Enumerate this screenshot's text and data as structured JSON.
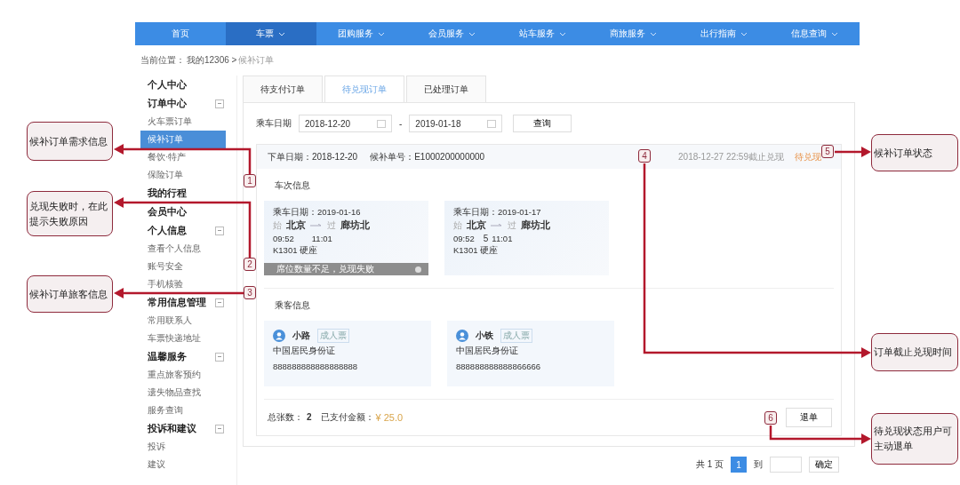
{
  "nav": [
    {
      "label": "首页",
      "selected": false,
      "dropdown": false
    },
    {
      "label": "车票",
      "selected": true,
      "dropdown": true
    },
    {
      "label": "团购服务",
      "selected": false,
      "dropdown": true
    },
    {
      "label": "会员服务",
      "selected": false,
      "dropdown": true
    },
    {
      "label": "站车服务",
      "selected": false,
      "dropdown": true
    },
    {
      "label": "商旅服务",
      "selected": false,
      "dropdown": true
    },
    {
      "label": "出行指南",
      "selected": false,
      "dropdown": true
    },
    {
      "label": "信息查询",
      "selected": false,
      "dropdown": true
    }
  ],
  "breadcrumb": {
    "label": "当前位置：",
    "path": "我的12306 >",
    "current": "候补订单"
  },
  "sidebar": [
    {
      "label": "个人中心",
      "collapsible": false
    },
    {
      "label": "订单中心",
      "collapsible": true,
      "children": [
        {
          "label": "火车票订单",
          "selected": false
        },
        {
          "label": "候补订单",
          "selected": true
        },
        {
          "label": "餐饮·特产",
          "selected": false
        },
        {
          "label": "保险订单",
          "selected": false
        }
      ]
    },
    {
      "label": "我的行程",
      "collapsible": false
    },
    {
      "label": "会员中心",
      "collapsible": false
    },
    {
      "label": "个人信息",
      "collapsible": true,
      "children": [
        {
          "label": "查看个人信息",
          "selected": false
        },
        {
          "label": "账号安全",
          "selected": false
        },
        {
          "label": "手机核验",
          "selected": false
        }
      ]
    },
    {
      "label": "常用信息管理",
      "collapsible": true,
      "children": [
        {
          "label": "常用联系人",
          "selected": false
        },
        {
          "label": "车票快递地址",
          "selected": false
        }
      ]
    },
    {
      "label": "温馨服务",
      "collapsible": true,
      "children": [
        {
          "label": "重点旅客预约",
          "selected": false
        },
        {
          "label": "遗失物品查找",
          "selected": false
        },
        {
          "label": "服务查询",
          "selected": false
        }
      ]
    },
    {
      "label": "投诉和建议",
      "collapsible": true,
      "children": [
        {
          "label": "投诉",
          "selected": false
        },
        {
          "label": "建议",
          "selected": false
        }
      ]
    }
  ],
  "tabs": [
    {
      "label": "待支付订单",
      "selected": false
    },
    {
      "label": "待兑现订单",
      "selected": true
    },
    {
      "label": "已处理订单",
      "selected": false
    }
  ],
  "filter": {
    "label": "乘车日期",
    "start": "2018-12-20",
    "separator": "-",
    "end": "2019-01-18",
    "button": "查询"
  },
  "order": {
    "date_label": "下单日期：",
    "date": "2018-12-20",
    "number_label": "候补单号：",
    "number": "E1000200000000",
    "deadline": "2018-12-27 22:59截止兑现",
    "status": "待兑现",
    "trips_title": "车次信息",
    "trips": [
      {
        "date": "乘车日期：2019-01-16",
        "from_tag": "始",
        "from": "北京",
        "to_tag": "过",
        "to": "廊坊北",
        "depart": "09:52",
        "arrive": "11:01",
        "train": "K1301 硬座",
        "failure": "席位数量不足，兑现失败"
      },
      {
        "date": "乘车日期：2019-01-17",
        "from_tag": "始",
        "from": "北京",
        "to_tag": "过",
        "to": "廊坊北",
        "depart": "09:52",
        "stray_mark": "5",
        "arrive": "11:01",
        "train": "K1301 硬座"
      }
    ],
    "passengers_title": "乘客信息",
    "passengers": [
      {
        "name": "小路",
        "tag": "成人票",
        "id_type": "中国居民身份证",
        "id_number": "888888888888888888"
      },
      {
        "name": "小铁",
        "tag": "成人票",
        "id_type": "中国居民身份证",
        "id_number": "888888888888866666"
      }
    ],
    "total_label": "总张数：",
    "total": "2",
    "paid_label": "已支付金额：",
    "paid": "¥ 25.0",
    "refund_button": "退单"
  },
  "pagination": {
    "pages": "共 1 页",
    "current": "1",
    "goto": "到",
    "confirm": "确定"
  },
  "annotations": [
    {
      "number": "1",
      "text": "候补订单需求信息"
    },
    {
      "number": "2",
      "text": "兑现失败时，在此提示失败原因"
    },
    {
      "number": "3",
      "text": "候补订单旅客信息"
    },
    {
      "number": "5",
      "text": "候补订单状态"
    },
    {
      "number": "4",
      "text": "订单截止兑现时间"
    },
    {
      "number": "6",
      "text": "待兑现状态用户可主动退单"
    }
  ]
}
